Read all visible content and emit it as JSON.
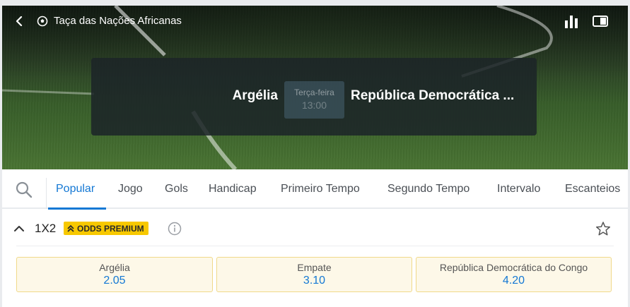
{
  "header": {
    "league": "Taça das Nações Africanas",
    "icons": {
      "back": "chevron-left-icon",
      "league": "soccer-ball-icon",
      "stats": "bar-chart-icon",
      "tv": "live-tv-icon"
    }
  },
  "match": {
    "home": "Argélia",
    "away": "República Democrática ...",
    "day": "Terça-feira",
    "time": "13:00"
  },
  "tabs": [
    "Popular",
    "Jogo",
    "Gols",
    "Handicap",
    "Primeiro Tempo",
    "Segundo Tempo",
    "Intervalo",
    "Escanteios"
  ],
  "active_tab": "Popular",
  "market": {
    "title": "1X2",
    "badge": "ODDS PREMIUM",
    "outcomes": [
      {
        "label": "Argélia",
        "odd": "2.05"
      },
      {
        "label": "Empate",
        "odd": "3.10"
      },
      {
        "label": "República Democrática do Congo",
        "odd": "4.20"
      }
    ]
  },
  "colors": {
    "accent": "#1478d4",
    "premium": "#f7c800",
    "odd_bg": "#fdf8e8",
    "odd_border": "#f0d98a"
  }
}
